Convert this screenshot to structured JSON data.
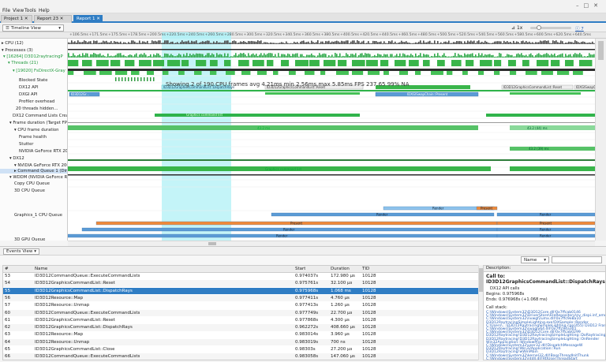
{
  "menu": [
    "File",
    "View",
    "Tools",
    "Help"
  ],
  "tabs": [
    "Project 1",
    "Report 23",
    "Report 1"
  ],
  "toolbar": {
    "view_select": "Timeline View",
    "zoom_label": "1x",
    "messages_label": "7 messages"
  },
  "ruler_ticks": [
    "+106.5ms",
    "+171.5ms",
    "+175.5ms",
    "+178.5ms",
    "+200.5ms",
    "+220.5ms",
    "+240.5ms",
    "+260.5ms",
    "+280.5ms",
    "+300.5ms",
    "+320.5ms",
    "+340.5ms",
    "+360.5ms",
    "+380.5ms",
    "+400.5ms",
    "+420.5ms",
    "+440.5ms",
    "+460.5ms",
    "+480.5ms",
    "+500.5ms",
    "+520.5ms",
    "+540.5ms",
    "+560.5ms",
    "+580.5ms",
    "+600.5ms",
    "+620.5ms",
    "+640.5ms"
  ],
  "tree": [
    {
      "label": "CPU (12)",
      "style": "",
      "sel": false
    },
    {
      "label": "Processes (3)",
      "style": "",
      "sel": false
    },
    {
      "label": "[16264] D3D12raytracingP",
      "style": "green",
      "sel": false
    },
    {
      "label": "Threads (21)",
      "style": "green",
      "sel": false
    },
    {
      "label": "[19020] FsDirectX-Gray",
      "style": "green",
      "sel": false
    },
    {
      "label": "Blocked State",
      "style": "",
      "sel": false
    },
    {
      "label": "DX12 API",
      "style": "",
      "sel": false
    },
    {
      "label": "DXGI API",
      "style": "",
      "sel": false
    },
    {
      "label": "Profiler overhead",
      "style": "",
      "sel": false
    },
    {
      "label": "20 threads hidden...",
      "style": "",
      "sel": false
    },
    {
      "label": "DX12 Command Lists Creatio",
      "style": "",
      "sel": false
    },
    {
      "label": "Frame duration (Target FPS: 6",
      "style": "",
      "sel": false
    },
    {
      "label": "CPU frame duration",
      "style": "",
      "sel": false
    },
    {
      "label": "Frame health",
      "style": "",
      "sel": false
    },
    {
      "label": "Stutter",
      "style": "",
      "sel": false
    },
    {
      "label": "NVIDIA GeForce RTX 2060",
      "style": "",
      "sel": false
    },
    {
      "label": "DX12",
      "style": "",
      "sel": false
    },
    {
      "label": "NVIDIA GeForce RTX 2060",
      "style": "",
      "sel": false
    },
    {
      "label": "Command Queue 1 (Direct)",
      "style": "",
      "sel": true
    },
    {
      "label": "WDDM (NVIDIA GeForce RTX",
      "style": "",
      "sel": false
    },
    {
      "label": "Copy CPU Queue",
      "style": "",
      "sel": false
    },
    {
      "label": "3D CPU Queue",
      "style": "",
      "sel": false
    },
    {
      "label": "Graphics_1 CPU Queue",
      "style": "",
      "sel": false
    },
    {
      "label": "3D GPU Queue",
      "style": "",
      "sel": false
    }
  ],
  "timeline_labels": {
    "blue1": "ID3D12Gr...",
    "blue_sel": "ID3D12GraphicsCommandList::DispatchRays",
    "green_long": "ID3D12CommandQueue::ExecuteCommandLists",
    "grey1": "ID3D12GraphicsCommandList::Reset",
    "grey2": "IDXGISwapChain::Present",
    "blue_mid": "ID3D12GraphicsCommandList::Reset",
    "blue_mid2": "IDXGISwapChain::Present",
    "cmdlist": "Graphics command list",
    "fps_bar": "43.2 ms",
    "fps_bar2": "43.2 (44) ms",
    "rtx_bar": "43.2 (39) ms",
    "queue_bar": "Graphics command list",
    "present": "Present",
    "render": "Render",
    "reset": "Reset"
  },
  "overlay_text": "Showing 2 of 190 CPU frames  avg 4.21ms  min 2.56ms  max 5.85ms  FPS 237.65 99% NA",
  "events": {
    "view_select": "Events View",
    "name_select": "Name",
    "columns": [
      "#",
      "Name",
      "Start",
      "Duration",
      "TID"
    ],
    "rows": [
      [
        "53",
        "ID3D12CommandQueue::ExecuteCommandLists",
        "0.974037s",
        "172.980 μs",
        "10128"
      ],
      [
        "54",
        "ID3D12GraphicsCommandList::Reset",
        "0.975761s",
        "32.100 μs",
        "10128"
      ],
      [
        "55",
        "ID3D12GraphicsCommandList::DispatchRays",
        "0.975968s",
        "1.068 ms",
        "10128"
      ],
      [
        "56",
        "ID3D12Resource::Map",
        "0.977411s",
        "4.760 μs",
        "10128"
      ],
      [
        "57",
        "ID3D12Resource::Unmap",
        "0.977413s",
        "1.260 μs",
        "10128"
      ],
      [
        "60",
        "ID3D12CommandQueue::ExecuteCommandLists",
        "0.977749s",
        "22.700 μs",
        "10128"
      ],
      [
        "61",
        "ID3D12GraphicsCommandList::Reset",
        "0.977868s",
        "4.300 μs",
        "10128"
      ],
      [
        "62",
        "ID3D12GraphicsCommandList::DispatchRays",
        "0.962272s",
        "408.660 μs",
        "10128"
      ],
      [
        "63",
        "ID3D12Resource::Map",
        "0.983014s",
        "3.960 μs",
        "10128"
      ],
      [
        "64",
        "ID3D12Resource::Unmap",
        "0.983019s",
        "700 ns",
        "10128"
      ],
      [
        "65",
        "ID3D12GraphicsCommandList::Close",
        "0.98303s",
        "27.200 μs",
        "10128"
      ],
      [
        "66",
        "ID3D12CommandQueue::ExecuteCommandLists",
        "0.983058s",
        "147.060 μs",
        "10128"
      ]
    ]
  },
  "description": {
    "header": "Description:",
    "call_to": "Call to:",
    "func": "ID3D12GraphicsCommandList::DispatchRays",
    "api": "DX12 API calls",
    "begins": "Begins: 0.975968s",
    "ends": "Ends: 0.976968s (+1.068 ms)",
    "callstack": "Call stack:",
    "stack": [
      "C:\\Windows\\System32\\D3D12Core.dll!0x7ffcab0146",
      "C:\\Windows\\System32\\DriverStore\\FileRepository\\nv_dispi.inf_amd64",
      "C:\\Windows\\System32\\nvwgf2umx.dll!0x7ffc9e8a10",
      "D3D12RaytracingSimpleLighting.exe!DXSample::Render",
      "C:\\Users\\...\\D3D12RaytracingSimpleLighting.cpp(455) D3D12 Frame(1)",
      "C:\\Windows\\System32\\nvoglv64.dll!0x7ffc94a301",
      "C:\\Windows\\System32\\D3D12Core.dll!0x7ffcab0299",
      "D3D12Raytracing!D3D12RaytracingSimpleLighting::DoRaytracing",
      "D3D12Raytracing!D3D12RaytracingSimpleLighting::OnRender",
      "Win32Application::WindowProc",
      "C:\\Windows\\System32\\user32.dll!DispatchMessageW",
      "D3D12Raytracing!Win32Application::Run",
      "D3D12Raytracing!wWinMain",
      "C:\\Windows\\System32\\kernel32.dll!BaseThreadInitThunk",
      "C:\\Windows\\System32\\ntdll.dll!RtlUserThreadStart"
    ]
  },
  "colors": {
    "accent": "#2f7dc4",
    "green": "#2fb34a",
    "blue": "#5b9bd5",
    "orange": "#f08a3a",
    "selection_cyan": "#a8f0f6"
  }
}
